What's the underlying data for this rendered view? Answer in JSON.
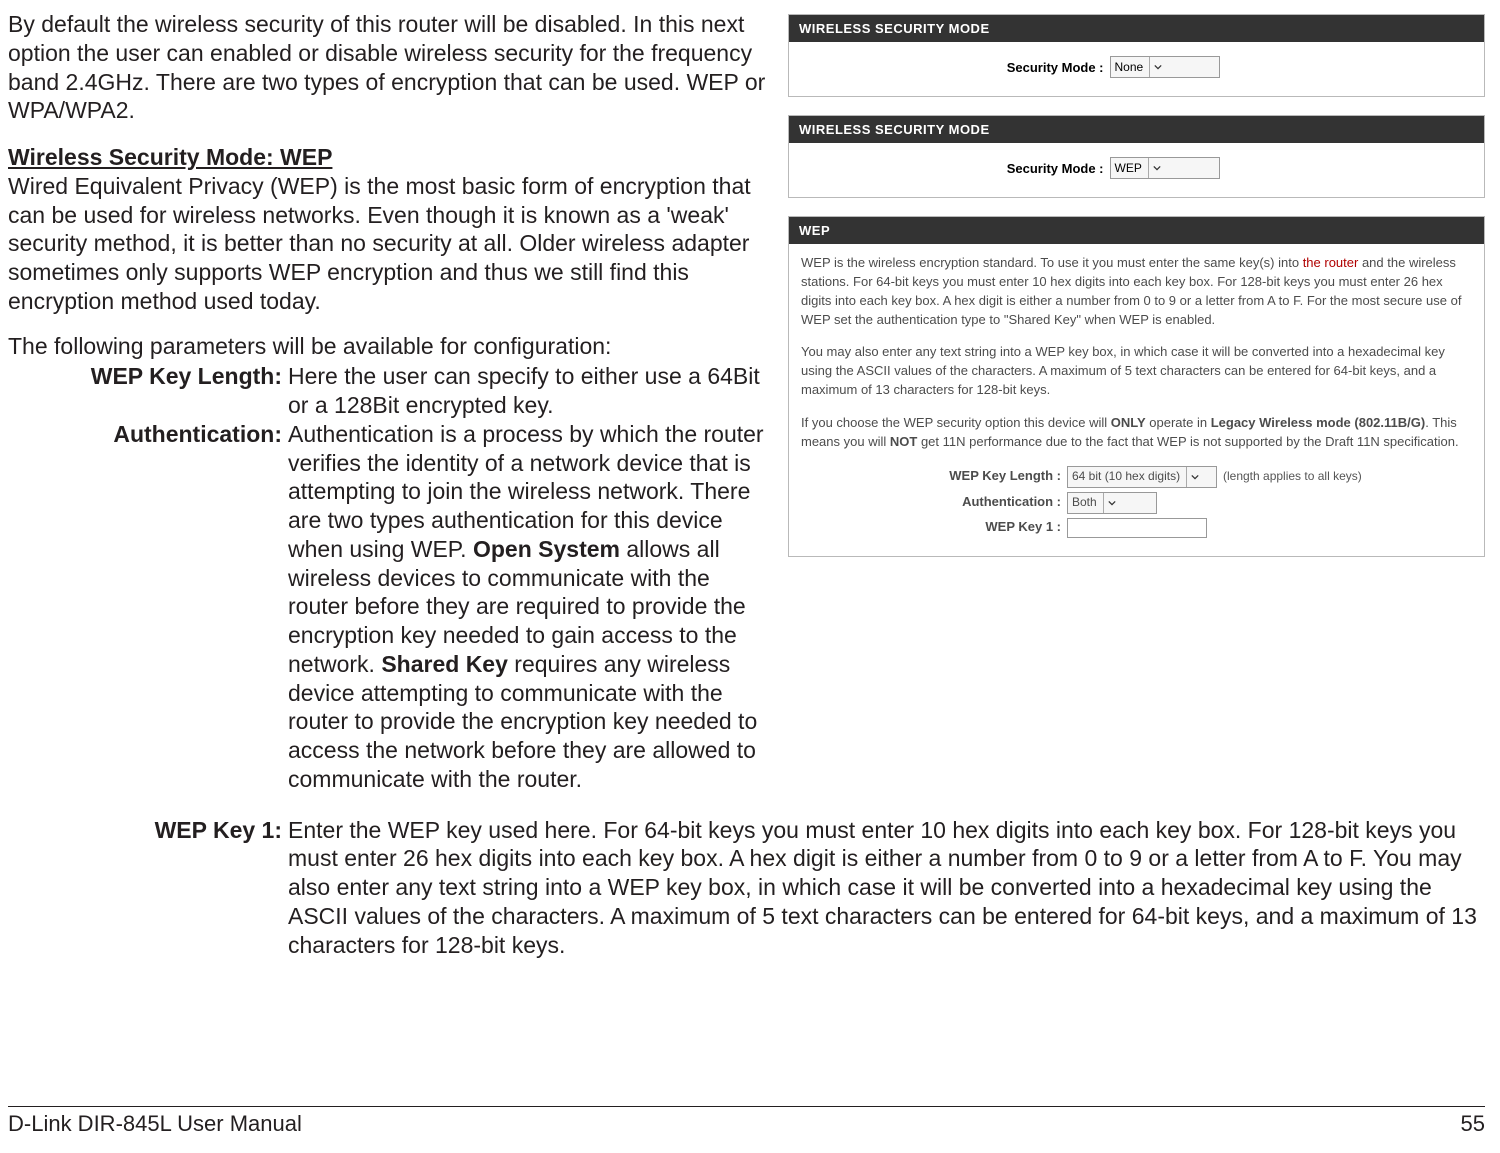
{
  "intro": "By default the wireless security of this router will be disabled. In this next option the user can enabled or disable wireless security for the frequency band 2.4GHz. There are two types of encryption that can be used. WEP or WPA/WPA2.",
  "wep_heading": "Wireless Security Mode: WEP",
  "wep_desc": "Wired Equivalent Privacy (WEP) is the most basic form of encryption that can be used for wireless networks. Even though it is known as a 'weak' security method, it is better than no security at all. Older wireless adapter sometimes only supports WEP encryption and thus we still find this encryption method used today.",
  "params_intro": "The following parameters will be available for configuration:",
  "params": {
    "wep_key_length": {
      "label": "WEP Key Length:",
      "text": "Here the user can specify to either use a 64Bit or a 128Bit encrypted key."
    },
    "authentication": {
      "label": "Authentication:",
      "pre": "Authentication is a process by which the router verifies the identity of a network device that is attempting to join the wireless network. There are two types authentication for this device when using WEP. ",
      "open_system": "Open System",
      "mid": " allows all wireless devices to communicate with the router before they are required to provide the encryption key needed to gain access to the network. ",
      "shared_key": "Shared Key",
      "post": " requires any wireless device attempting to communicate with the router to provide the encryption key needed to access the network before they are allowed to communicate with the router."
    },
    "wep_key_1": {
      "label": "WEP Key 1:",
      "text": "Enter the WEP key used here. For 64-bit keys you must enter 10 hex digits into each key box. For 128-bit keys you must enter 26 hex digits into each key box. A hex digit is either a number from 0 to 9 or a letter from A to F. You may also enter any text string into a WEP key box, in which case it will be converted into a hexadecimal key using the ASCII values of the characters. A maximum of 5 text characters can be entered for 64-bit keys, and a maximum of 13 characters for 128-bit keys."
    }
  },
  "panel1": {
    "title": "WIRELESS SECURITY MODE",
    "label": "Security Mode  :",
    "value": "None"
  },
  "panel2": {
    "title": "WIRELESS SECURITY MODE",
    "label": "Security Mode  :",
    "value": "WEP"
  },
  "panel3": {
    "title": "WEP",
    "p1a": "WEP is the wireless encryption standard. To use it you must enter the same key(s) into ",
    "p1b": "the router",
    "p1c": " and the wireless stations. For 64-bit keys you must enter 10 hex digits into each key box. For 128-bit keys you must enter 26 hex digits into each key box. A hex digit is either a number from 0 to 9 or a letter from A to F. For the most secure use of WEP set the authentication type to \"Shared Key\" when WEP is enabled.",
    "p2": "You may also enter any text string into a WEP key box, in which case it will be converted into a hexadecimal key using the ASCII values of the characters. A maximum of 5 text characters can be entered for 64-bit keys, and a maximum of 13 characters for 128-bit keys.",
    "p3a": "If you choose the WEP security option this device will ",
    "p3b": "ONLY",
    "p3c": " operate in ",
    "p3d": "Legacy Wireless mode (802.11B/G)",
    "p3e": ". This means you will ",
    "p3f": "NOT",
    "p3g": " get 11N performance due to the fact that WEP is not supported by the Draft 11N specification.",
    "form": {
      "wep_key_length_label": "WEP Key Length  :",
      "wep_key_length_value": "64 bit (10 hex digits)",
      "wep_key_length_suffix": "(length applies to all keys)",
      "auth_label": "Authentication  :",
      "auth_value": "Both",
      "wep_key1_label": "WEP Key 1  :"
    }
  },
  "footer": {
    "left": "D-Link DIR-845L User Manual",
    "right": "55"
  }
}
